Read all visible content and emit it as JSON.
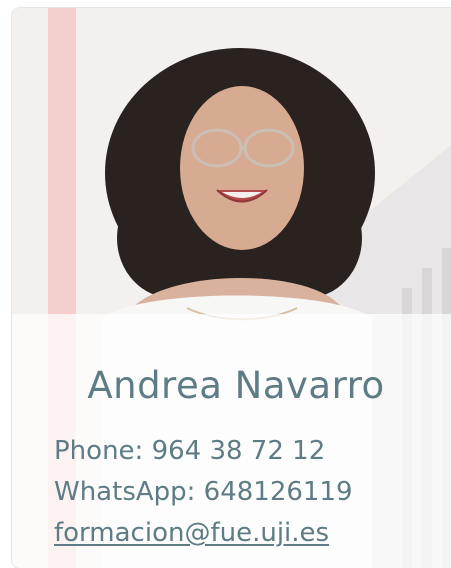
{
  "contact": {
    "name": "Andrea Navarro",
    "phone": "Phone: 964 38 72 12",
    "whatsapp": "WhatsApp: 648126119",
    "email": "formacion@fue.uji.es"
  },
  "colors": {
    "text": "#5e7c85",
    "background": "#f3efec",
    "accent_stripe": "#f2c8c8"
  },
  "icons": {
    "photo": "portrait-photo"
  }
}
